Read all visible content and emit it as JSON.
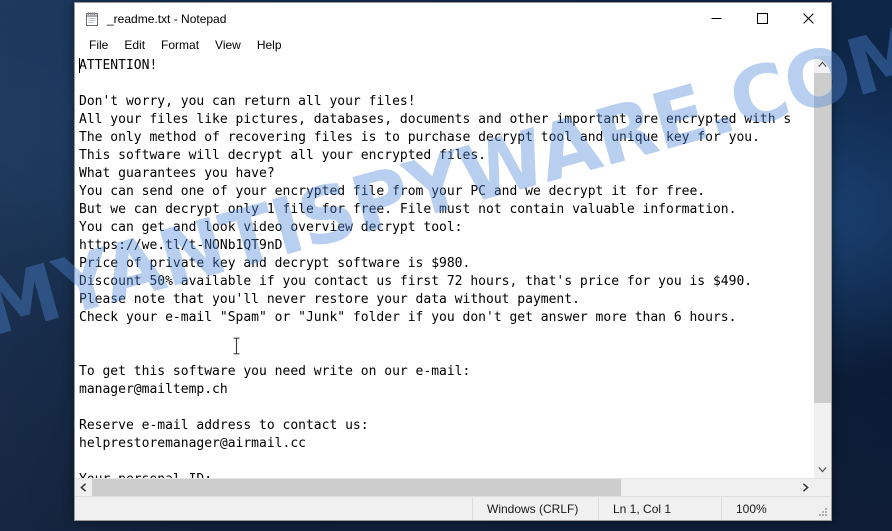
{
  "desktop": {
    "background_color": "#0d2546",
    "watermark": "MYANTISPYWARE.COM",
    "watermark_color": "#4f86d6"
  },
  "window": {
    "title": "_readme.txt - Notepad",
    "icon": "notepad-icon",
    "controls": {
      "minimize": "–",
      "maximize": "☐",
      "close": "✕"
    }
  },
  "menubar": {
    "items": [
      {
        "label": "File"
      },
      {
        "label": "Edit"
      },
      {
        "label": "Format"
      },
      {
        "label": "View"
      },
      {
        "label": "Help"
      }
    ]
  },
  "document": {
    "filename": "_readme.txt",
    "lines": [
      "ATTENTION!",
      "",
      "Don't worry, you can return all your files!",
      "All your files like pictures, databases, documents and other important are encrypted with s",
      "The only method of recovering files is to purchase decrypt tool and unique key for you.",
      "This software will decrypt all your encrypted files.",
      "What guarantees you have?",
      "You can send one of your encrypted file from your PC and we decrypt it for free.",
      "But we can decrypt only 1 file for free. File must not contain valuable information.",
      "You can get and look video overview decrypt tool:",
      "https://we.tl/t-NONb1QT9nD",
      "Price of private key and decrypt software is $980.",
      "Discount 50% available if you contact us first 72 hours, that's price for you is $490.",
      "Please note that you'll never restore your data without payment.",
      "Check your e-mail \"Spam\" or \"Junk\" folder if you don't get answer more than 6 hours.",
      "",
      "",
      "To get this software you need write on our e-mail:",
      "manager@mailtemp.ch",
      "",
      "Reserve e-mail address to contact us:",
      "helprestoremanager@airmail.cc",
      "",
      "Your personal ID:"
    ],
    "details": {
      "video_url": "https://we.tl/t-NONb1QT9nD",
      "price": "$980",
      "discount_price": "$490",
      "discount_percent": "50%",
      "discount_window_hours": "72 hours",
      "answer_window_hours": "6 hours",
      "primary_email": "manager@mailtemp.ch",
      "reserve_email": "helprestoremanager@airmail.cc"
    }
  },
  "statusbar": {
    "encoding": "Windows (CRLF)",
    "position": "Ln 1, Col 1",
    "zoom": "100%"
  },
  "scrollbars": {
    "vertical_up": "⌃",
    "vertical_down": "⌄",
    "horizontal_left": "‹",
    "horizontal_right": "›"
  }
}
